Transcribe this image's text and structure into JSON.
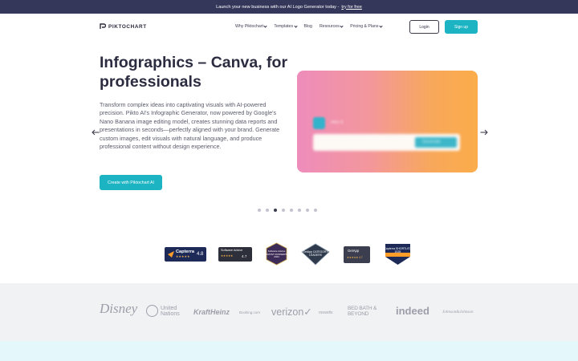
{
  "promo": {
    "text": "Launch your new business with our AI Logo Generator today -",
    "link": "try for free"
  },
  "header": {
    "logo_text": "PIKTOCHART",
    "menu": [
      {
        "label": "Why Piktochart",
        "dropdown": true
      },
      {
        "label": "Templates",
        "dropdown": true
      },
      {
        "label": "Blog",
        "dropdown": false
      },
      {
        "label": "Resources",
        "dropdown": true
      },
      {
        "label": "Pricing & Plans",
        "dropdown": true
      }
    ],
    "login_label": "Login",
    "signup_label": "Sign up"
  },
  "hero": {
    "title": "Infographics – Canva, for professionals",
    "description": "Transform complex ideas into captivating visuals with AI-powered precision. Pikto AI's Infographic Generator, now powered by Google's Nano Banana image editing model, creates stunning data reports and presentations in seconds—perfectly aligned with your brand. Generate custom images, edit visuals with natural language, and produce professional content without design experience.",
    "cta_label": "Create with Piktochart AI",
    "card": {
      "chip_text": "Hi!s ß",
      "bar_button_text": "Generate"
    }
  },
  "carousel": {
    "dot_count": 8,
    "active_index": 2
  },
  "badges": {
    "capterra": {
      "name": "Capterra",
      "stars": "★★★★★",
      "rating": "4.8"
    },
    "software_advice": {
      "name": "Software Advice",
      "stars": "★★★★★",
      "rating": "4.7"
    },
    "front_runners": {
      "text": "Software Advice FRONT RUNNERS 2024"
    },
    "getapp_leaders": {
      "text": "GetApp CATEGORY LEADERS"
    },
    "getapp_rating": {
      "name": "GetApp",
      "stars": "★★★★★ 4.7"
    },
    "capterra_shortlist": {
      "text": "Capterra SHORTLIST 2025"
    }
  },
  "customer_logos": {
    "disney": "Disney",
    "un": "United Nations",
    "kraft": "KraftHeinz",
    "booking": "Booking.com",
    "verizon": "verizon✓",
    "novartis": "novartis",
    "bbb": "BED BATH & BEYOND",
    "indeed": "indeed",
    "jj": "Johnson&Johnson"
  },
  "colors": {
    "promo_bg": "#35375a",
    "accent": "#1cb4c2",
    "logos_band": "#f1f2f4",
    "bottom_band": "#e4f7fa"
  }
}
